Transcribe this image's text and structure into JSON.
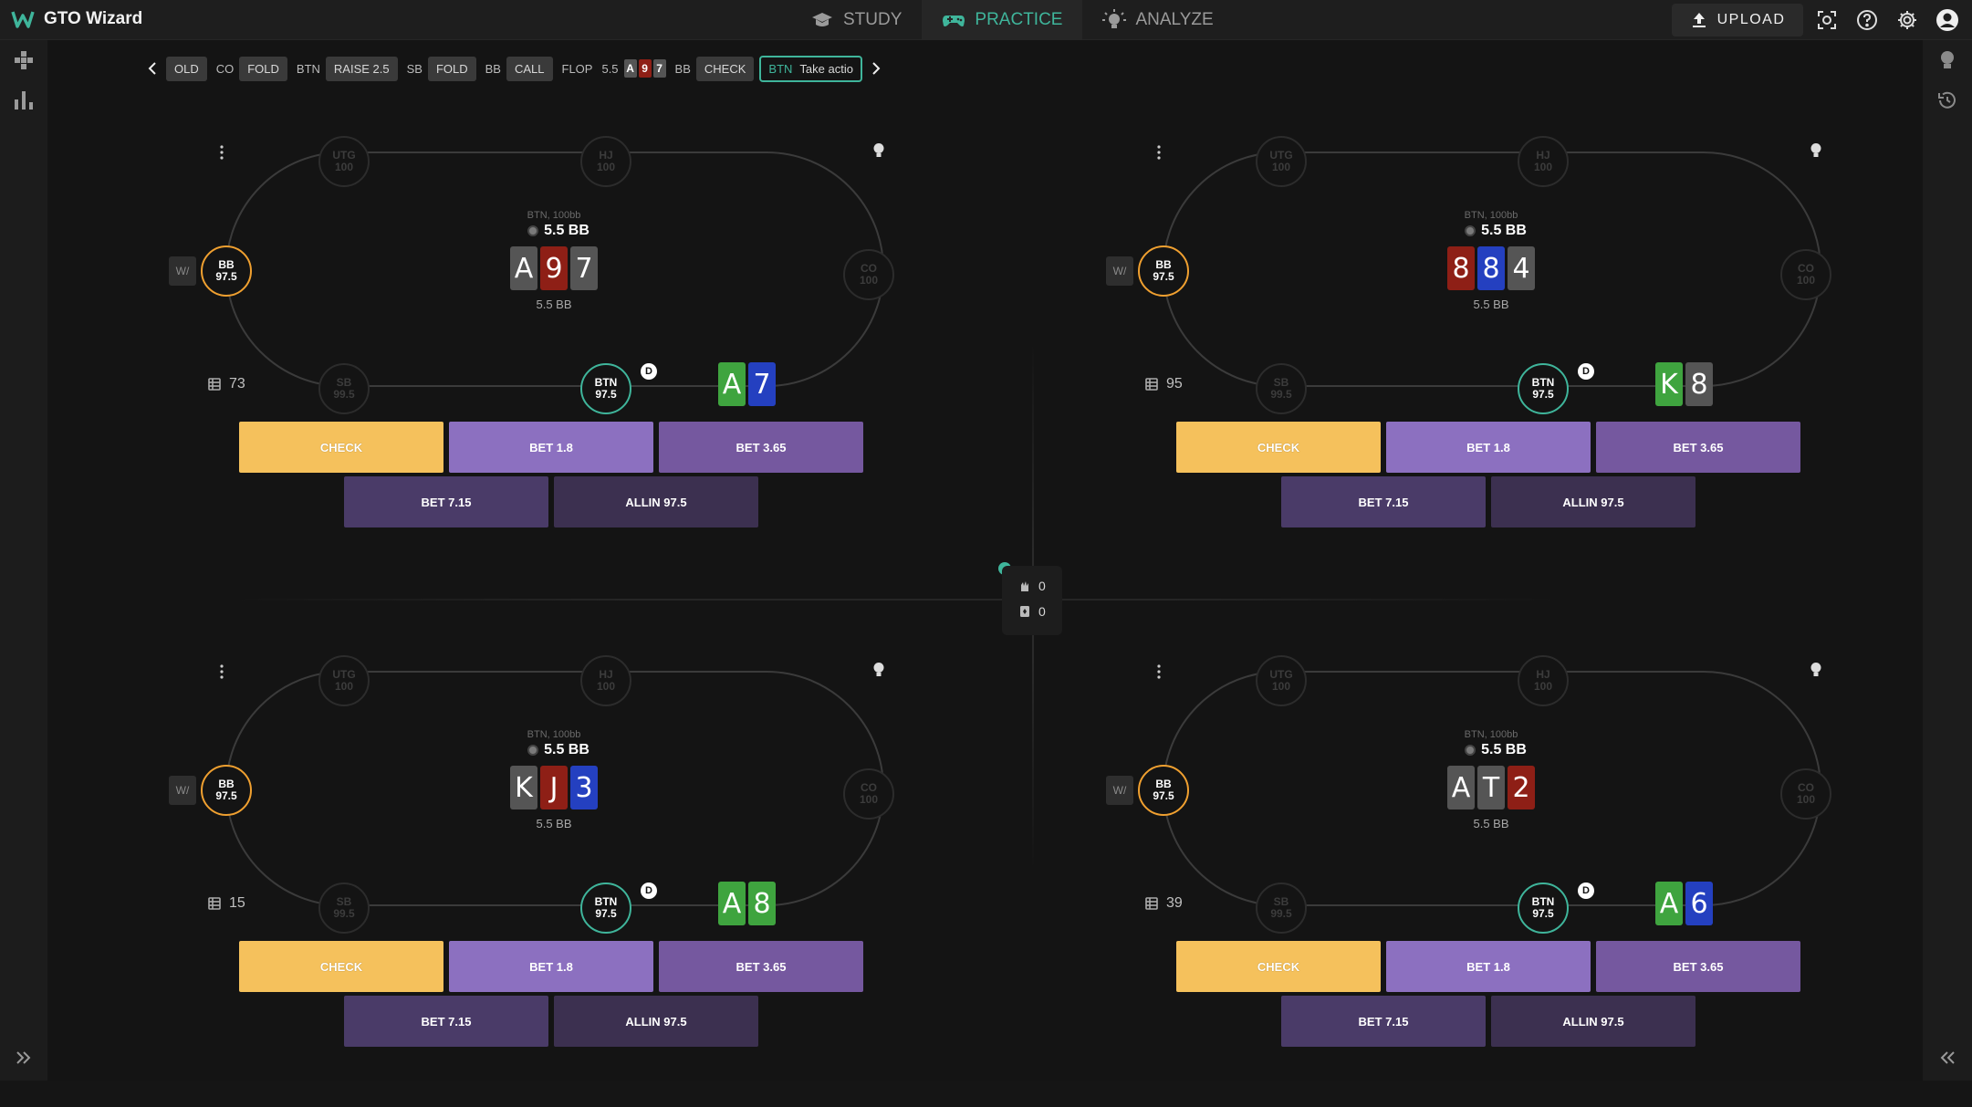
{
  "app": {
    "name": "GTO Wizard"
  },
  "nav": {
    "tabs": [
      {
        "label": "STUDY",
        "icon": "graduation-cap-icon",
        "active": false
      },
      {
        "label": "PRACTICE",
        "icon": "gamepad-icon",
        "active": true
      },
      {
        "label": "ANALYZE",
        "icon": "lightbulb-icon",
        "active": false
      }
    ],
    "upload_label": "UPLOAD",
    "accent_color": "#3fb59b"
  },
  "history": {
    "items": [
      {
        "pos": "",
        "action": "OLD"
      },
      {
        "pos": "CO",
        "action": "FOLD"
      },
      {
        "pos": "BTN",
        "action": "RAISE 2.5"
      },
      {
        "pos": "SB",
        "action": "FOLD"
      },
      {
        "pos": "BB",
        "action": "CALL"
      }
    ],
    "flop_label": "FLOP",
    "flop_pot": "5.5",
    "flop_cards": [
      "A",
      "9",
      "7"
    ],
    "bb_pos": "BB",
    "bb_action": "CHECK",
    "active_pos": "BTN",
    "active_text": "Take actio"
  },
  "counter": {
    "hands": "0",
    "cards": "0"
  },
  "tables": [
    {
      "pot_label": "BTN, 100bb",
      "pot": "5.5 BB",
      "pot_sub": "5.5 BB",
      "board": [
        {
          "rank": "A",
          "color": "#555555"
        },
        {
          "rank": "9",
          "color": "#8e1f16"
        },
        {
          "rank": "7",
          "color": "#555555"
        }
      ],
      "hero": [
        {
          "rank": "A",
          "color": "#3fa43f"
        },
        {
          "rank": "7",
          "color": "#2440c0"
        }
      ],
      "hand_count": "73",
      "seats": {
        "utg": [
          "UTG",
          "100"
        ],
        "hj": [
          "HJ",
          "100"
        ],
        "co": [
          "CO",
          "100"
        ],
        "bb": [
          "BB",
          "97.5"
        ],
        "sb": [
          "SB",
          "99.5"
        ],
        "btn": [
          "BTN",
          "97.5"
        ]
      },
      "wa": "W/",
      "dealer": "D",
      "actions": [
        "CHECK",
        "BET 1.8",
        "BET 3.65",
        "BET 7.15",
        "ALLIN 97.5"
      ]
    },
    {
      "pot_label": "BTN, 100bb",
      "pot": "5.5 BB",
      "pot_sub": "5.5 BB",
      "board": [
        {
          "rank": "8",
          "color": "#8e1f16"
        },
        {
          "rank": "8",
          "color": "#2440c0"
        },
        {
          "rank": "4",
          "color": "#555555"
        }
      ],
      "hero": [
        {
          "rank": "K",
          "color": "#3fa43f"
        },
        {
          "rank": "8",
          "color": "#555555"
        }
      ],
      "hand_count": "95",
      "seats": {
        "utg": [
          "UTG",
          "100"
        ],
        "hj": [
          "HJ",
          "100"
        ],
        "co": [
          "CO",
          "100"
        ],
        "bb": [
          "BB",
          "97.5"
        ],
        "sb": [
          "SB",
          "99.5"
        ],
        "btn": [
          "BTN",
          "97.5"
        ]
      },
      "wa": "W/",
      "dealer": "D",
      "actions": [
        "CHECK",
        "BET 1.8",
        "BET 3.65",
        "BET 7.15",
        "ALLIN 97.5"
      ]
    },
    {
      "pot_label": "BTN, 100bb",
      "pot": "5.5 BB",
      "pot_sub": "5.5 BB",
      "board": [
        {
          "rank": "K",
          "color": "#555555"
        },
        {
          "rank": "J",
          "color": "#8e1f16"
        },
        {
          "rank": "3",
          "color": "#2440c0"
        }
      ],
      "hero": [
        {
          "rank": "A",
          "color": "#3fa43f"
        },
        {
          "rank": "8",
          "color": "#3fa43f"
        }
      ],
      "hand_count": "15",
      "seats": {
        "utg": [
          "UTG",
          "100"
        ],
        "hj": [
          "HJ",
          "100"
        ],
        "co": [
          "CO",
          "100"
        ],
        "bb": [
          "BB",
          "97.5"
        ],
        "sb": [
          "SB",
          "99.5"
        ],
        "btn": [
          "BTN",
          "97.5"
        ]
      },
      "wa": "W/",
      "dealer": "D",
      "actions": [
        "CHECK",
        "BET 1.8",
        "BET 3.65",
        "BET 7.15",
        "ALLIN 97.5"
      ]
    },
    {
      "pot_label": "BTN, 100bb",
      "pot": "5.5 BB",
      "pot_sub": "5.5 BB",
      "board": [
        {
          "rank": "A",
          "color": "#555555"
        },
        {
          "rank": "T",
          "color": "#555555"
        },
        {
          "rank": "2",
          "color": "#8e1f16"
        }
      ],
      "hero": [
        {
          "rank": "A",
          "color": "#3fa43f"
        },
        {
          "rank": "6",
          "color": "#2440c0"
        }
      ],
      "hand_count": "39",
      "seats": {
        "utg": [
          "UTG",
          "100"
        ],
        "hj": [
          "HJ",
          "100"
        ],
        "co": [
          "CO",
          "100"
        ],
        "bb": [
          "BB",
          "97.5"
        ],
        "sb": [
          "SB",
          "99.5"
        ],
        "btn": [
          "BTN",
          "97.5"
        ]
      },
      "wa": "W/",
      "dealer": "D",
      "actions": [
        "CHECK",
        "BET 1.8",
        "BET 3.65",
        "BET 7.15",
        "ALLIN 97.5"
      ]
    }
  ]
}
